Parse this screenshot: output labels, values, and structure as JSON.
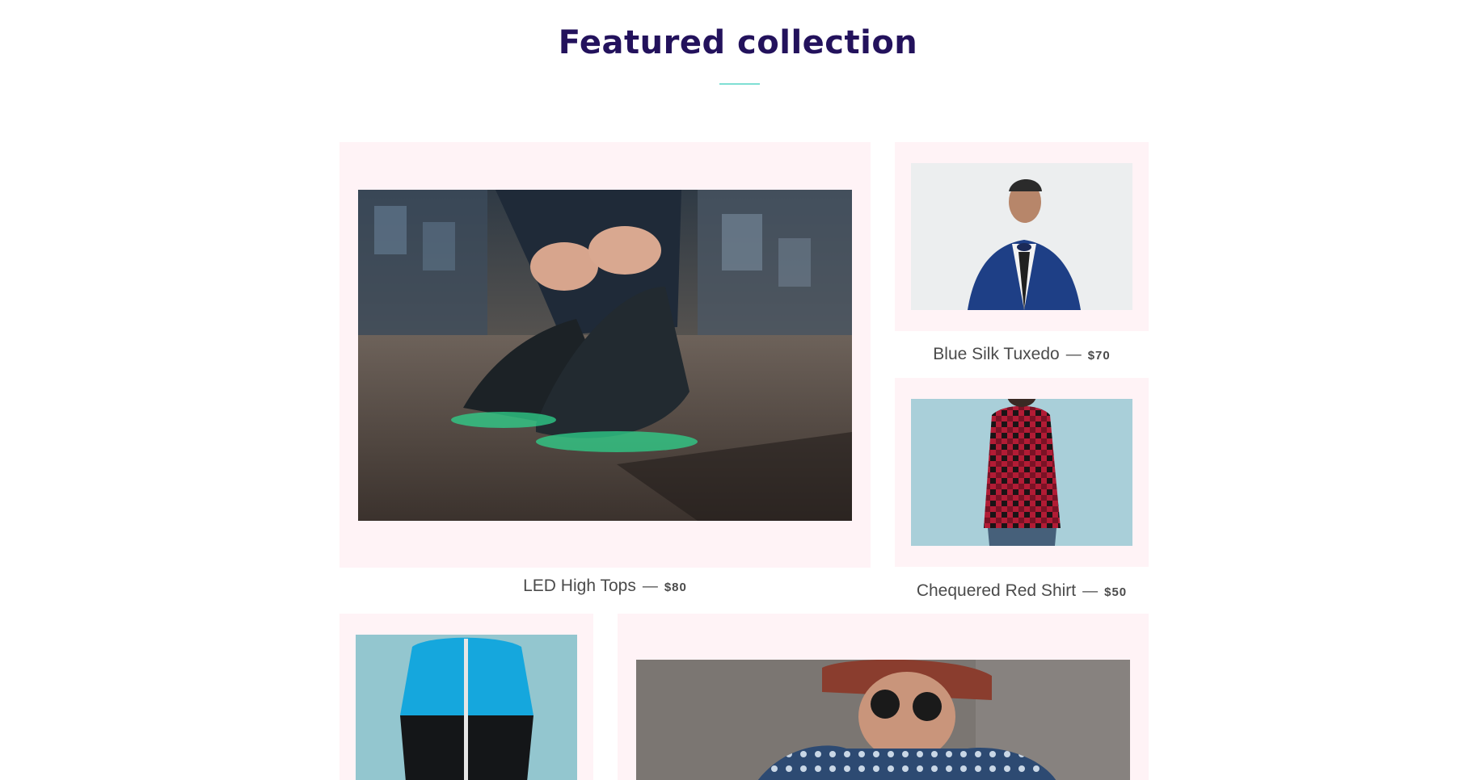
{
  "section": {
    "title": "Featured collection",
    "accent_color": "#7fdfd4",
    "title_color": "#23125c",
    "card_bg": "#fff3f6"
  },
  "products": [
    {
      "name": "LED High Tops",
      "separator": "—",
      "price": "$80",
      "image": "sneakers-photo"
    },
    {
      "name": "Blue Silk Tuxedo",
      "separator": "—",
      "price": "$70",
      "image": "tuxedo-photo"
    },
    {
      "name": "Chequered Red Shirt",
      "separator": "—",
      "price": "$50",
      "image": "plaid-shirt-photo"
    },
    {
      "name": "",
      "separator": "",
      "price": "",
      "image": "windbreaker-photo"
    },
    {
      "name": "",
      "separator": "",
      "price": "",
      "image": "patterned-shirt-photo"
    }
  ]
}
